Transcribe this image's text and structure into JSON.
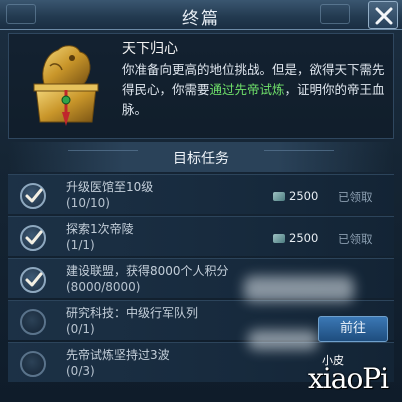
{
  "window": {
    "title": "终篇"
  },
  "intro": {
    "title": "天下归心",
    "text_a": "你准备向更高的地位挑战。但是，欲得天下需先得民心，你需要",
    "text_highlight": "通过先帝试炼",
    "text_b": "，证明你的帝王血脉。"
  },
  "section": {
    "title": "目标任务"
  },
  "tasks": [
    {
      "name": "升级医馆至10级",
      "progress": "(10/10)",
      "reward": "2500",
      "status": "已领取",
      "done": true
    },
    {
      "name": "探索1次帝陵",
      "progress": "(1/1)",
      "reward": "2500",
      "status": "已领取",
      "done": true
    },
    {
      "name": "建设联盟，获得8000个人积分",
      "progress": "(8000/8000)",
      "reward": "",
      "status": "",
      "done": true
    },
    {
      "name": "研究科技：中级行军队列",
      "progress": "(0/1)",
      "reward": "",
      "status": "",
      "done": false
    },
    {
      "name": "先帝试炼坚持过3波",
      "progress": "(0/3)",
      "reward": "",
      "status": "",
      "done": false
    }
  ],
  "go_button": "前往",
  "watermark": {
    "small": "小皮",
    "big": "xiaoPi"
  },
  "colors": {
    "highlight": "#6fe06a",
    "accent": "#3b78b5"
  },
  "icons": {
    "check": "check-icon",
    "close": "close-icon",
    "gem": "gem-icon"
  }
}
